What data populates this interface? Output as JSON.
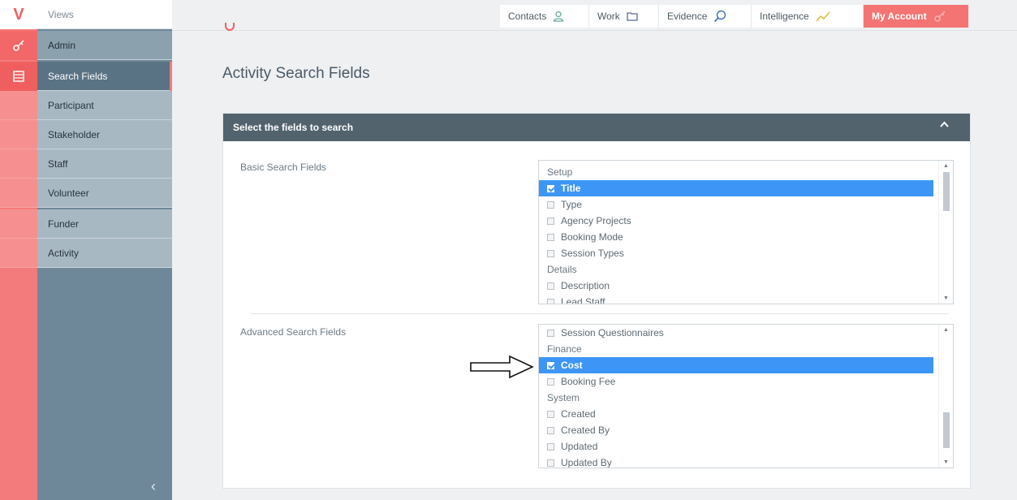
{
  "brand": {
    "logo": "V"
  },
  "rail": {
    "icons": [
      "key-icon",
      "list-icon"
    ]
  },
  "sidebar": {
    "views_label": "Views",
    "items": [
      {
        "label": "Admin"
      },
      {
        "label": "Search Fields"
      },
      {
        "label": "Participant"
      },
      {
        "label": "Stakeholder"
      },
      {
        "label": "Staff"
      },
      {
        "label": "Volunteer"
      },
      {
        "label": "Funder"
      },
      {
        "label": "Activity"
      }
    ],
    "collapse_glyph": "‹"
  },
  "topnav": {
    "contacts": "Contacts",
    "work": "Work",
    "evidence": "Evidence",
    "intelligence": "Intelligence",
    "account": "My Account"
  },
  "main": {
    "title": "Activity Search Fields",
    "panel": {
      "header": "Select the fields to search",
      "basic": {
        "label": "Basic Search Fields",
        "rows": [
          {
            "text": "Setup",
            "type": "group"
          },
          {
            "text": "Title",
            "type": "option",
            "checked": true
          },
          {
            "text": "Type",
            "type": "option",
            "checked": false
          },
          {
            "text": "Agency Projects",
            "type": "option",
            "checked": false
          },
          {
            "text": "Booking Mode",
            "type": "option",
            "checked": false
          },
          {
            "text": "Session Types",
            "type": "option",
            "checked": false
          },
          {
            "text": "Details",
            "type": "group"
          },
          {
            "text": "Description",
            "type": "option",
            "checked": false
          },
          {
            "text": "Lead Staff",
            "type": "option",
            "checked": false
          }
        ]
      },
      "advanced": {
        "label": "Advanced Search Fields",
        "rows": [
          {
            "text": "Session Questionnaires",
            "type": "option",
            "checked": false
          },
          {
            "text": "Finance",
            "type": "group"
          },
          {
            "text": "Cost",
            "type": "option",
            "checked": true
          },
          {
            "text": "Booking Fee",
            "type": "option",
            "checked": false
          },
          {
            "text": "System",
            "type": "group"
          },
          {
            "text": "Created",
            "type": "option",
            "checked": false
          },
          {
            "text": "Created By",
            "type": "option",
            "checked": false
          },
          {
            "text": "Updated",
            "type": "option",
            "checked": false
          },
          {
            "text": "Updated By",
            "type": "option",
            "checked": false
          }
        ]
      }
    }
  },
  "colors": {
    "accent": "#f47b7b",
    "sidebar": "#6f8899",
    "selection": "#3d96f5",
    "panel_header": "#52636e"
  }
}
